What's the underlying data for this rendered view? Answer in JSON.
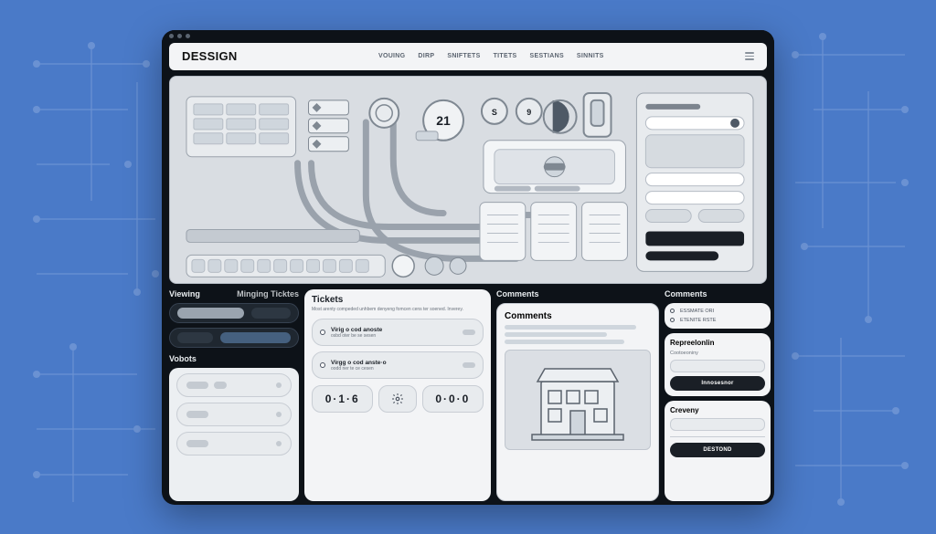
{
  "header": {
    "logo": "DESSIGN",
    "nav": [
      "VOUING",
      "DIRP",
      "SNIFTETS",
      "TITETS",
      "SESTIANS",
      "SINNITS"
    ]
  },
  "dashboard": {
    "gauge_center": "21",
    "gauge_right_1": "S",
    "gauge_right_2": "9"
  },
  "lower": {
    "left_labels": {
      "viewing": "Viewing",
      "managing": "Minging Ticktes",
      "vobots": "Vobots"
    },
    "tickets": {
      "title": "Tickets",
      "sub": "Most arenty compeded unhbem denyeng fomcen cens ter soened. Inverey.",
      "row1_t": "Virig o cod anoste",
      "row1_s": "osbd oter be se sesen",
      "row2_t": "Virgg o cod anste·o",
      "row2_s": "oodd ner te ce cesen",
      "stat1": "0·1·6",
      "stat2": "0·0·0"
    },
    "col3_label": "Comments",
    "comments": {
      "title": "Comments"
    },
    "right_label": "Comments",
    "right": {
      "top_opt1": "ESSMATE ORI",
      "top_opt2": "ETENITE RSTE",
      "mid_title": "Repreelonlin",
      "mid_sub": "Cootoeoniny",
      "mid_btn": "Innosesnor",
      "bot_title": "Creveny",
      "bot_btn": "DESTOND"
    }
  }
}
